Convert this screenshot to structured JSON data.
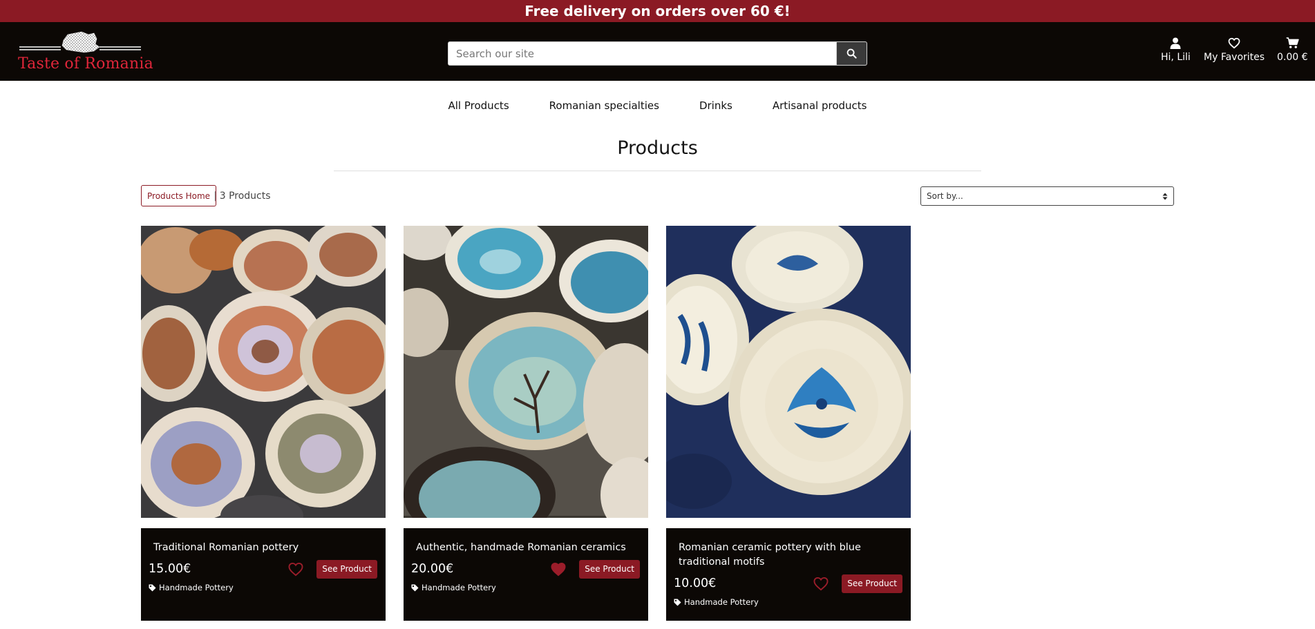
{
  "promo": {
    "text": "Free delivery on orders over 60 €!"
  },
  "header": {
    "logo_text": "Taste of Romania",
    "search": {
      "placeholder": "Search our site",
      "value": ""
    },
    "account_label": "Hi, Lili",
    "favorites_label": "My Favorites",
    "cart_label": "0.00 €"
  },
  "nav": {
    "items": [
      {
        "label": "All Products"
      },
      {
        "label": "Romanian specialties"
      },
      {
        "label": "Drinks"
      },
      {
        "label": "Artisanal products"
      }
    ]
  },
  "main": {
    "title": "Products",
    "home_button": "Products Home",
    "separator": "|",
    "count_text": "3 Products",
    "sort_value": "Sort by..."
  },
  "products": [
    {
      "title": "Traditional Romanian pottery",
      "price": "15.00€",
      "category": "Handmade Pottery",
      "button": "See Product",
      "favorited": false
    },
    {
      "title": "Authentic, handmade Romanian ceramics",
      "price": "20.00€",
      "category": "Handmade Pottery",
      "button": "See Product",
      "favorited": true
    },
    {
      "title": "Romanian ceramic pottery with blue traditional motifs",
      "price": "10.00€",
      "category": "Handmade Pottery",
      "button": "See Product",
      "favorited": false
    }
  ],
  "colors": {
    "brand_red": "#8b1a24",
    "logo_red": "#e0263a",
    "header_bg": "#0c0805",
    "white": "#ffffff"
  },
  "icons": {
    "search": "search-icon",
    "account": "user-icon",
    "favorites": "heart-icon",
    "cart": "cart-icon",
    "tag": "tag-icon"
  }
}
